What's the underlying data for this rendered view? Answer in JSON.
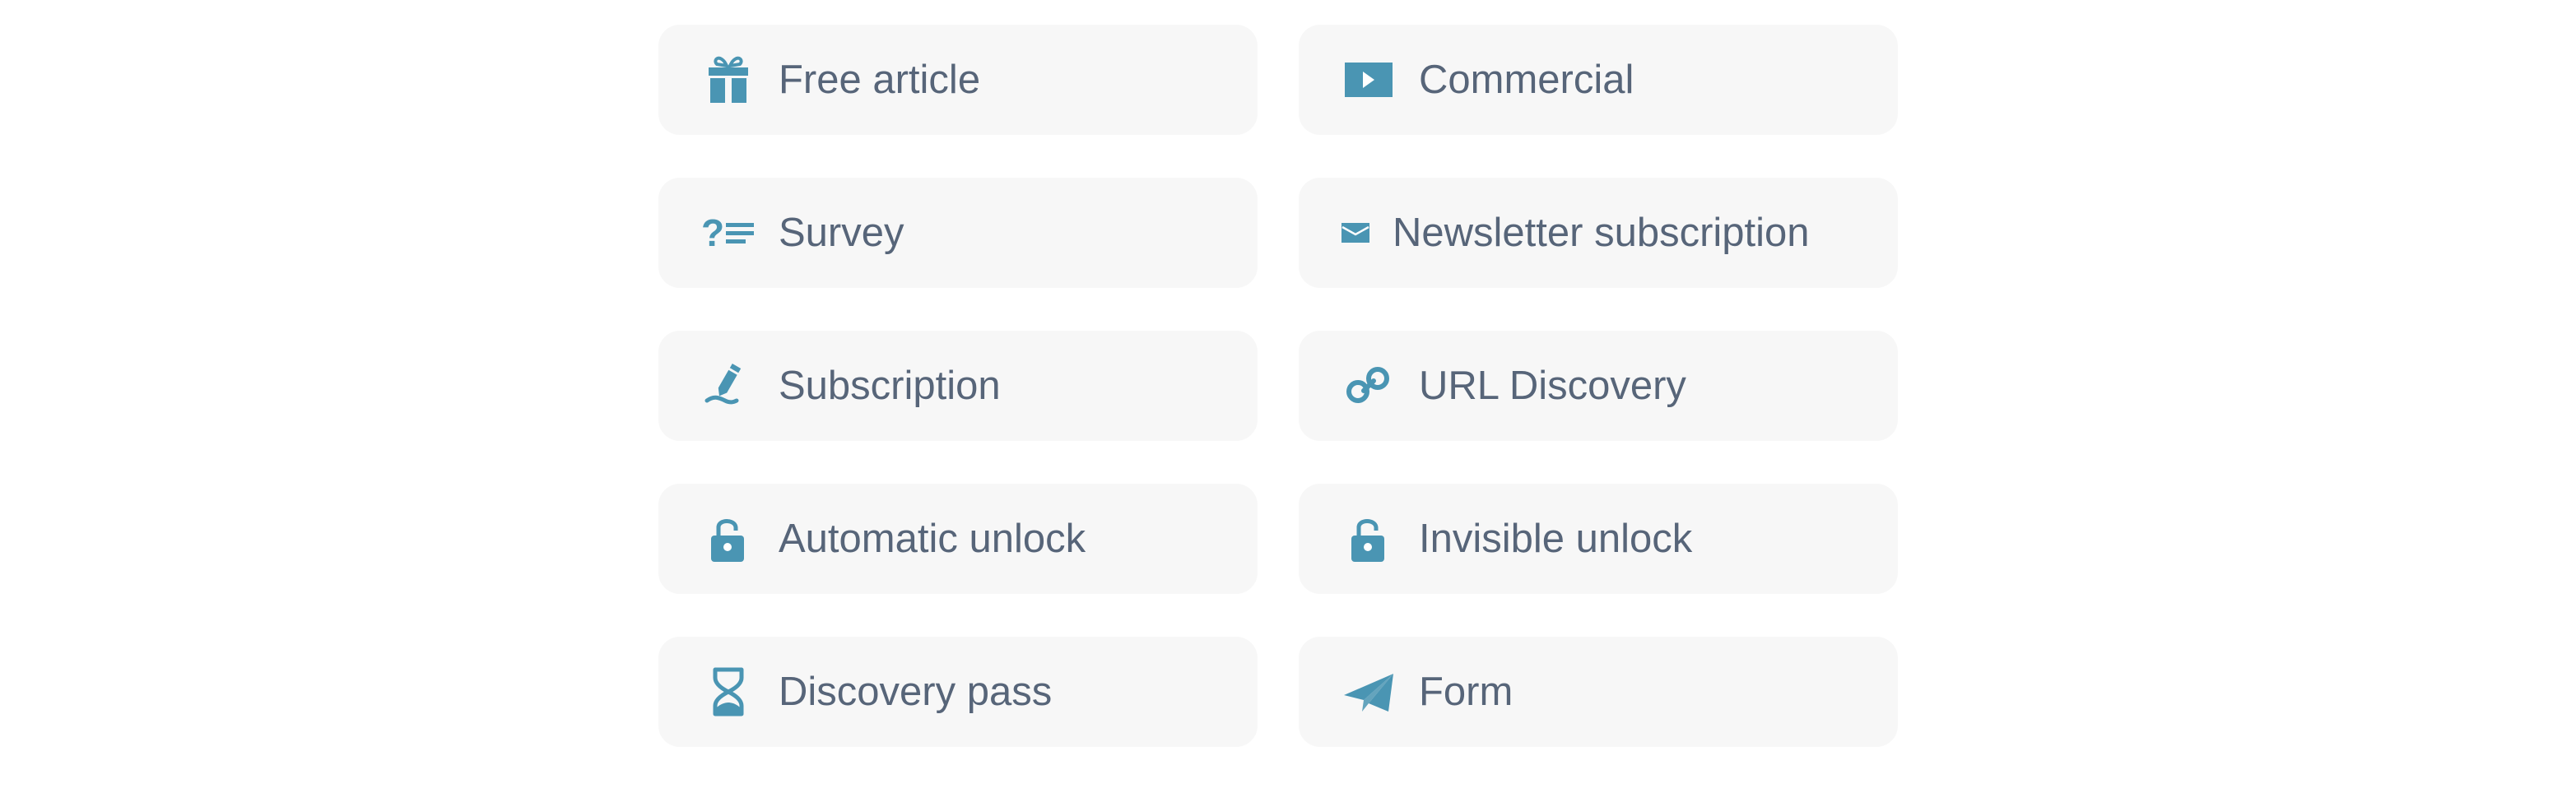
{
  "theme": {
    "icon_color": "#4a95b3",
    "text_color": "#576579",
    "card_background": "#f7f7f7"
  },
  "options": [
    {
      "id": "free-article",
      "label": "Free article",
      "icon": "gift-icon"
    },
    {
      "id": "commercial",
      "label": "Commercial",
      "icon": "video-play-icon"
    },
    {
      "id": "survey",
      "label": "Survey",
      "icon": "question-list-icon"
    },
    {
      "id": "newsletter-subscription",
      "label": "Newsletter subscription",
      "icon": "envelope-icon"
    },
    {
      "id": "subscription",
      "label": "Subscription",
      "icon": "signature-pen-icon"
    },
    {
      "id": "url-discovery",
      "label": "URL Discovery",
      "icon": "link-icon"
    },
    {
      "id": "automatic-unlock",
      "label": "Automatic unlock",
      "icon": "unlock-icon"
    },
    {
      "id": "invisible-unlock",
      "label": "Invisible unlock",
      "icon": "unlock-icon"
    },
    {
      "id": "discovery-pass",
      "label": "Discovery pass",
      "icon": "hourglass-icon"
    },
    {
      "id": "form",
      "label": "Form",
      "icon": "paper-plane-icon"
    }
  ]
}
